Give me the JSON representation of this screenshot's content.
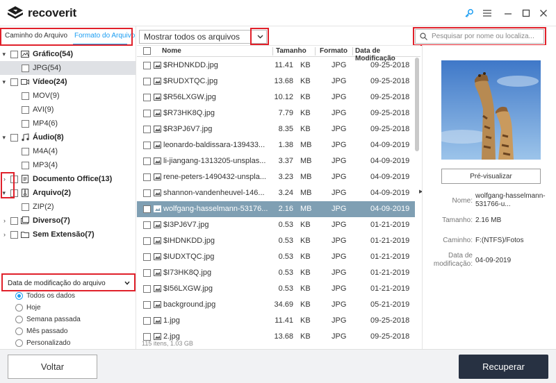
{
  "app": {
    "brand": "recoverit"
  },
  "window_controls": {
    "key": "key-icon",
    "menu": "menu-icon",
    "minimize": "minimize-icon",
    "maximize": "maximize-icon",
    "close": "close-icon"
  },
  "left": {
    "tabs": [
      "Caminho do Arquivo",
      "Formato do Arquivo"
    ],
    "tree": [
      {
        "label": "Gráfico(54)",
        "level": 0,
        "bold": true,
        "icon": "image-icon"
      },
      {
        "label": "JPG(54)",
        "level": 1,
        "bold": false,
        "icon": ""
      },
      {
        "label": "Vídeo(24)",
        "level": 0,
        "bold": true,
        "icon": "video-icon"
      },
      {
        "label": "MOV(9)",
        "level": 1,
        "bold": false,
        "icon": ""
      },
      {
        "label": "AVI(9)",
        "level": 1,
        "bold": false,
        "icon": ""
      },
      {
        "label": "MP4(6)",
        "level": 1,
        "bold": false,
        "icon": ""
      },
      {
        "label": "Áudio(8)",
        "level": 0,
        "bold": true,
        "icon": "music-icon"
      },
      {
        "label": "M4A(4)",
        "level": 1,
        "bold": false,
        "icon": ""
      },
      {
        "label": "MP3(4)",
        "level": 1,
        "bold": false,
        "icon": ""
      },
      {
        "label": "Documento Office(13)",
        "level": 0,
        "bold": true,
        "icon": "document-icon"
      },
      {
        "label": "Arquivo(2)",
        "level": 0,
        "bold": true,
        "icon": "archive-icon"
      },
      {
        "label": "ZIP(2)",
        "level": 1,
        "bold": false,
        "icon": ""
      },
      {
        "label": "Diverso(7)",
        "level": 0,
        "bold": true,
        "icon": "misc-icon"
      },
      {
        "label": "Sem Extensão(7)",
        "level": 0,
        "bold": true,
        "icon": "folder-icon"
      }
    ],
    "filter_label": "Data de modificação do arquivo",
    "radios": [
      "Todos os dados",
      "Hoje",
      "Semana passada",
      "Mês passado",
      "Personalizado"
    ],
    "radio_selected": "Todos os dados"
  },
  "toolbar": {
    "show_all": "Mostrar todos os arquivos",
    "search_placeholder": "Pesquisar por nome ou localiza..."
  },
  "table": {
    "headers": [
      "Nome",
      "Tamanho",
      "Formato",
      "Data de Modificação"
    ],
    "rows": [
      {
        "name": "$RHDNKDD.jpg",
        "size": "11.41",
        "unit": "KB",
        "format": "JPG",
        "date": "09-25-2018"
      },
      {
        "name": "$RUDXTQC.jpg",
        "size": "13.68",
        "unit": "KB",
        "format": "JPG",
        "date": "09-25-2018"
      },
      {
        "name": "$R56LXGW.jpg",
        "size": "10.12",
        "unit": "KB",
        "format": "JPG",
        "date": "09-25-2018"
      },
      {
        "name": "$R73HK8Q.jpg",
        "size": "7.79",
        "unit": "KB",
        "format": "JPG",
        "date": "09-25-2018"
      },
      {
        "name": "$R3PJ6V7.jpg",
        "size": "8.35",
        "unit": "KB",
        "format": "JPG",
        "date": "09-25-2018"
      },
      {
        "name": "leonardo-baldissara-139433...",
        "size": "1.38",
        "unit": "MB",
        "format": "JPG",
        "date": "04-09-2019"
      },
      {
        "name": "li-jiangang-1313205-unsplas...",
        "size": "3.37",
        "unit": "MB",
        "format": "JPG",
        "date": "04-09-2019"
      },
      {
        "name": "rene-peters-1490432-unspla...",
        "size": "3.23",
        "unit": "MB",
        "format": "JPG",
        "date": "04-09-2019"
      },
      {
        "name": "shannon-vandenheuvel-146...",
        "size": "3.24",
        "unit": "MB",
        "format": "JPG",
        "date": "04-09-2019"
      },
      {
        "name": "wolfgang-hasselmann-53176...",
        "size": "2.16",
        "unit": "MB",
        "format": "JPG",
        "date": "04-09-2019"
      },
      {
        "name": "$I3PJ6V7.jpg",
        "size": "0.53",
        "unit": "KB",
        "format": "JPG",
        "date": "01-21-2019"
      },
      {
        "name": "$IHDNKDD.jpg",
        "size": "0.53",
        "unit": "KB",
        "format": "JPG",
        "date": "01-21-2019"
      },
      {
        "name": "$IUDXTQC.jpg",
        "size": "0.53",
        "unit": "KB",
        "format": "JPG",
        "date": "01-21-2019"
      },
      {
        "name": "$I73HK8Q.jpg",
        "size": "0.53",
        "unit": "KB",
        "format": "JPG",
        "date": "01-21-2019"
      },
      {
        "name": "$I56LXGW.jpg",
        "size": "0.53",
        "unit": "KB",
        "format": "JPG",
        "date": "01-21-2019"
      },
      {
        "name": "background.jpg",
        "size": "34.69",
        "unit": "KB",
        "format": "JPG",
        "date": "05-21-2019"
      },
      {
        "name": "1.jpg",
        "size": "11.41",
        "unit": "KB",
        "format": "JPG",
        "date": "09-25-2018"
      },
      {
        "name": "2.jpg",
        "size": "13.68",
        "unit": "KB",
        "format": "JPG",
        "date": "09-25-2018"
      }
    ],
    "selected_row": 9,
    "status": "115 itens, 1.03 GB"
  },
  "preview": {
    "button": "Pré-visualizar",
    "name_label": "Nome:",
    "name_value": "wolfgang-hasselmann-531766-u...",
    "size_label": "Tamanho:",
    "size_value": "2.16 MB",
    "path_label": "Caminho:",
    "path_value": "F:(NTFS)/Fotos",
    "date_label": "Data de modificação:",
    "date_value": "04-09-2019"
  },
  "footer": {
    "back": "Voltar",
    "recover": "Recuperar"
  },
  "colors": {
    "accent": "#1a9df2",
    "selected_row": "#7f9fb3",
    "recover_button": "#273142",
    "highlight_box": "#e0202a"
  }
}
